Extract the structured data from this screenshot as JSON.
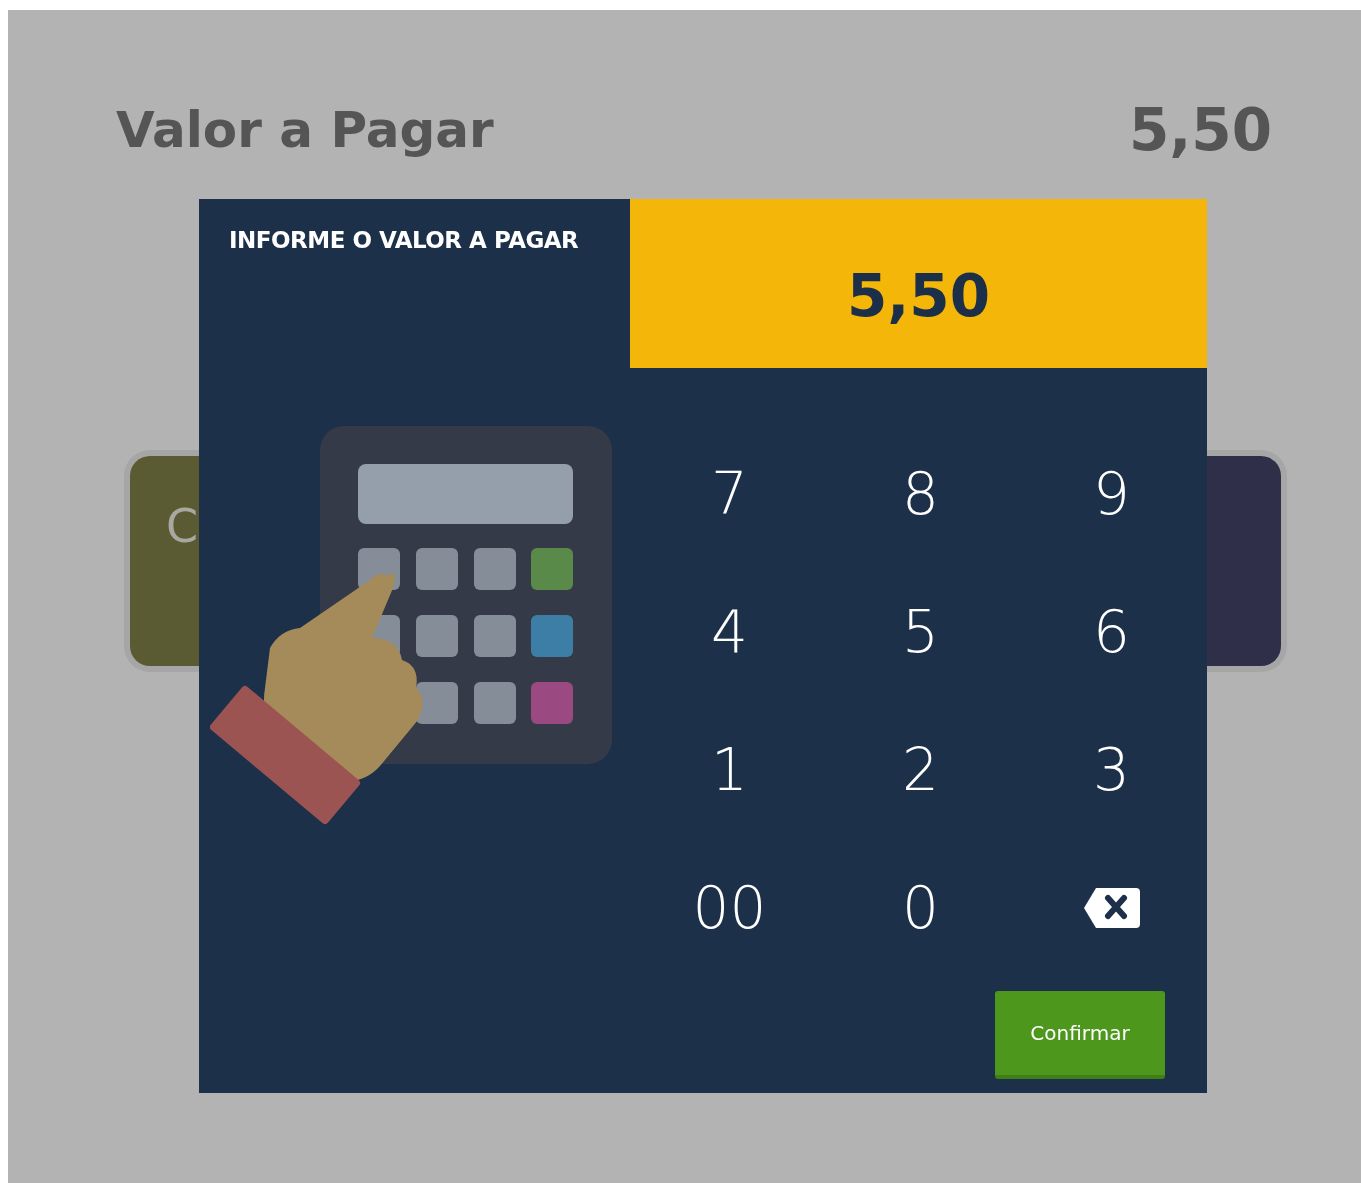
{
  "header": {
    "label": "Valor a Pagar",
    "amount": "5,50"
  },
  "background_cards": [
    {
      "text": "C",
      "color": "#5a5a33"
    },
    {
      "color": "#2f2f4a"
    }
  ],
  "dialog": {
    "title": "INFORME O VALOR A PAGAR",
    "display": "5,50",
    "keys": [
      {
        "kind": "digit",
        "label": "7"
      },
      {
        "kind": "digit",
        "label": "8"
      },
      {
        "kind": "digit",
        "label": "9"
      },
      {
        "kind": "digit",
        "label": "4"
      },
      {
        "kind": "digit",
        "label": "5"
      },
      {
        "kind": "digit",
        "label": "6"
      },
      {
        "kind": "digit",
        "label": "1"
      },
      {
        "kind": "digit",
        "label": "2"
      },
      {
        "kind": "digit",
        "label": "3"
      },
      {
        "kind": "digit",
        "label": "00"
      },
      {
        "kind": "digit",
        "label": "0"
      },
      {
        "kind": "backspace"
      }
    ],
    "confirm_button": "Confirmar"
  }
}
